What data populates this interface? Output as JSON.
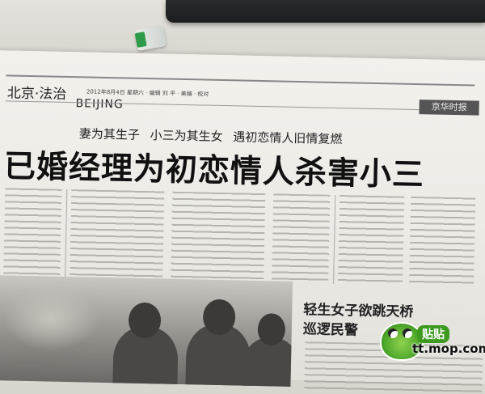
{
  "newspaper": {
    "section_cn": "北京·法治",
    "section_en": "BEIJING",
    "date_line": "2012年8月4日 星期六 · 编辑 刘 平 · 美编 · 校对",
    "paper_logo": "京华时报",
    "subhead": "妻为其生子 小三为其生女 遇初恋情人旧情复燃",
    "headline": "已婚经理为初恋情人杀害小三",
    "sub_story_line1": "轻生女子欲跳天桥",
    "sub_story_line2": "巡逻民警"
  },
  "watermark": {
    "badge": "贴贴",
    "site": "tt.mop.com"
  },
  "colors": {
    "paper": "#efede8",
    "ink": "#111111",
    "keyboard": "#1f2022",
    "watermark_green": "#4ea82a"
  }
}
